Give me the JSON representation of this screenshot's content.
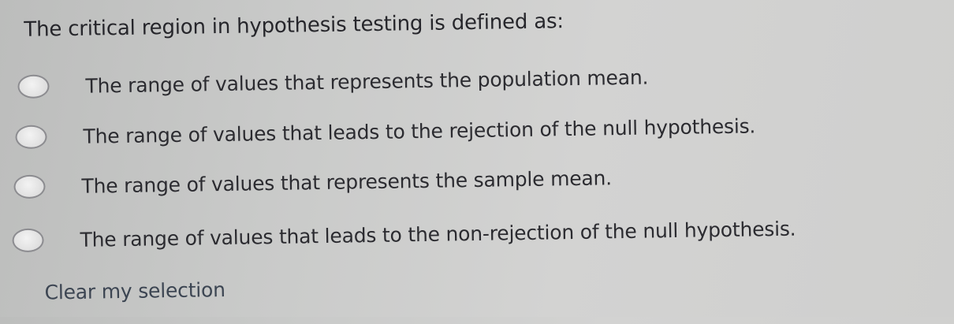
{
  "question": {
    "text": "The critical region in hypothesis testing is defined as:"
  },
  "options": [
    {
      "label": "The range of values that represents the population mean.",
      "selected": false
    },
    {
      "label": "The range of values that leads to the rejection of the null hypothesis.",
      "selected": false
    },
    {
      "label": "The range of values that represents the sample mean.",
      "selected": false
    },
    {
      "label": "The range of values that leads to the non-rejection of the null hypothesis.",
      "selected": false
    }
  ],
  "clear_selection_label": "Clear my selection",
  "colors": {
    "text": "#2b2b30",
    "link": "#3c4552",
    "radio_border": "#8c8c90"
  }
}
